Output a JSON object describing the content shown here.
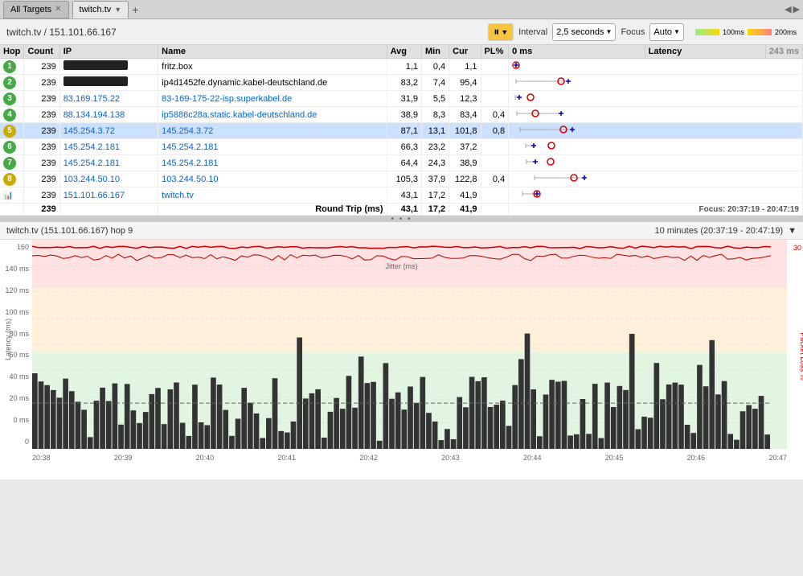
{
  "tabs": [
    {
      "id": "all-targets",
      "label": "All Targets",
      "active": false,
      "closable": true
    },
    {
      "id": "twitch",
      "label": "twitch.tv",
      "active": true,
      "closable": false
    }
  ],
  "breadcrumb": "twitch.tv / 151.101.66.167",
  "toolbar": {
    "pause_icon": "⏸",
    "interval_label": "Interval",
    "interval_value": "2,5 seconds",
    "focus_label": "Focus",
    "focus_value": "Auto",
    "legend_100": "100ms",
    "legend_200": "200ms"
  },
  "table": {
    "headers": [
      "Hop",
      "Count",
      "IP",
      "Name",
      "Avg",
      "Min",
      "Cur",
      "PL%",
      "0 ms",
      "Latency",
      "243 ms"
    ],
    "rows": [
      {
        "hop": 1,
        "color": "green",
        "count": 239,
        "ip": "",
        "ip_masked": true,
        "name": "fritz.box",
        "avg": "1,1",
        "min": "0,4",
        "cur": "1,1",
        "pl": "",
        "bar_avg": 5,
        "bar_min": 2,
        "bar_cur": 5
      },
      {
        "hop": 2,
        "color": "green",
        "count": 239,
        "ip": "",
        "ip_masked": true,
        "name": "ip4d1452fe.dynamic.kabel-deutschland.de",
        "avg": "83,2",
        "min": "7,4",
        "cur": "95,4",
        "pl": "",
        "bar_avg": 68,
        "bar_min": 6,
        "bar_cur": 78
      },
      {
        "hop": 3,
        "color": "green",
        "count": 239,
        "ip": "83.169.175.22",
        "ip_masked": false,
        "name": "83-169-175-22-isp.superkabel.de",
        "avg": "31,9",
        "min": "5,5",
        "cur": "12,3",
        "pl": "",
        "bar_avg": 26,
        "bar_min": 4,
        "bar_cur": 10
      },
      {
        "hop": 4,
        "color": "green",
        "count": 239,
        "ip": "88.134.194.138",
        "ip_masked": false,
        "name": "ip5886c28a.static.kabel-deutschland.de",
        "avg": "38,9",
        "min": "8,3",
        "cur": "83,4",
        "pl": "0,4",
        "bar_avg": 32,
        "bar_min": 7,
        "bar_cur": 68
      },
      {
        "hop": 5,
        "color": "yellow",
        "count": 239,
        "ip": "145.254.3.72",
        "ip_masked": false,
        "name": "145.254.3.72",
        "avg": "87,1",
        "min": "13,1",
        "cur": "101,8",
        "pl": "0,8",
        "bar_avg": 71,
        "bar_min": 11,
        "bar_cur": 83,
        "selected": true
      },
      {
        "hop": 6,
        "color": "green",
        "count": 239,
        "ip": "145.254.2.181",
        "ip_masked": false,
        "name": "145.254.2.181",
        "avg": "66,3",
        "min": "23,2",
        "cur": "37,2",
        "pl": "",
        "bar_avg": 54,
        "bar_min": 19,
        "bar_cur": 30
      },
      {
        "hop": 7,
        "color": "green",
        "count": 239,
        "ip": "145.254.2.181",
        "ip_masked": false,
        "name": "145.254.2.181",
        "avg": "64,4",
        "min": "24,3",
        "cur": "38,9",
        "pl": "",
        "bar_avg": 53,
        "bar_min": 20,
        "bar_cur": 32
      },
      {
        "hop": 8,
        "color": "yellow",
        "count": 239,
        "ip": "103.244.50.10",
        "ip_masked": false,
        "name": "103.244.50.10",
        "avg": "105,3",
        "min": "37,9",
        "cur": "122,8",
        "pl": "0,4",
        "bar_avg": 86,
        "bar_min": 31,
        "bar_cur": 100
      },
      {
        "hop": 9,
        "color": "green",
        "count": 239,
        "ip": "151.101.66.167",
        "ip_masked": false,
        "name": "twitch.tv",
        "avg": "43,1",
        "min": "17,2",
        "cur": "41,9",
        "pl": "",
        "bar_avg": 35,
        "bar_min": 14,
        "bar_cur": 34,
        "chart_icon": true
      }
    ],
    "footer": {
      "label": "Round Trip (ms)",
      "avg": "43,1",
      "min": "17,2",
      "cur": "41,9"
    }
  },
  "focus_footer": "Focus: 20:37:19 - 20:47:19",
  "divider_dots": "• • •",
  "bottom_chart": {
    "title": "twitch.tv (151.101.66.167) hop 9",
    "time_range": "10 minutes (20:37:19 - 20:47:19)",
    "expand_icon": "▼",
    "y_labels": [
      "160",
      "140 ms",
      "120 ms",
      "100 ms",
      "80 ms",
      "60 ms",
      "40 ms",
      "20 ms",
      "0 ms",
      "0"
    ],
    "x_labels": [
      "20:38",
      "20:39",
      "20:40",
      "20:41",
      "20:42",
      "20:43",
      "20:44",
      "20:45",
      "20:46",
      "20:47"
    ],
    "pl_labels": [
      "30",
      "",
      ""
    ],
    "jitter_label": "Jitter (ms)",
    "pl_axis_title": "Packet Loss %",
    "y_axis_title": "Latency (ms)"
  }
}
